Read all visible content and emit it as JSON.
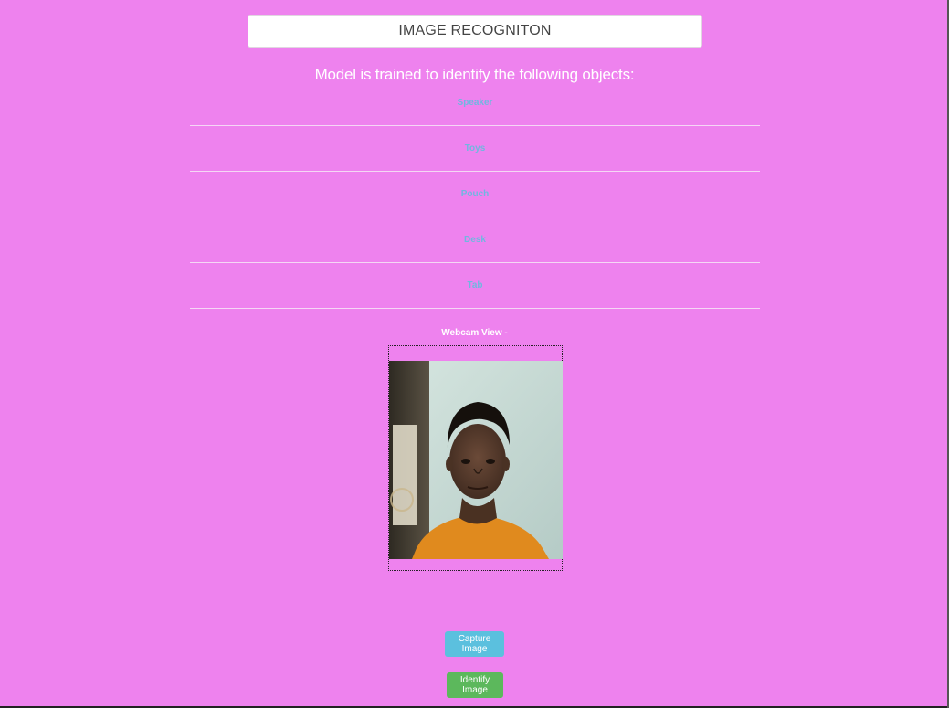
{
  "header": {
    "title": "IMAGE RECOGNITON"
  },
  "intro": {
    "text": "Model is trained to identify the following objects:"
  },
  "objects": [
    "Speaker",
    "Toys",
    "Pouch",
    "Desk",
    "Tab"
  ],
  "webcam": {
    "label": "Webcam View -"
  },
  "buttons": {
    "capture_label": "Capture Image",
    "identify_label": "Identify Image"
  },
  "colors": {
    "background": "#ee82ee",
    "object_text": "#5bc0de",
    "capture_button": "#5bc0de",
    "identify_button": "#5cb85c"
  }
}
